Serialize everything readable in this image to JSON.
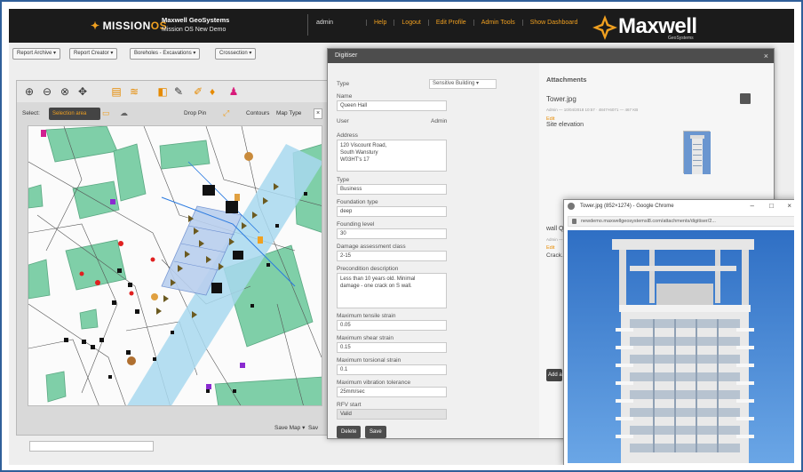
{
  "header": {
    "logo_mission": "MISSION",
    "logo_os": "OS",
    "company": "Maxwell GeoSystems",
    "subtitle": "Mission OS New Demo",
    "user": "admin",
    "nav": [
      "Help",
      "Logout",
      "Edit Profile",
      "Admin Tools",
      "Show Dashboard"
    ],
    "brand": "Maxwell",
    "brand_sub": "GeoSystems"
  },
  "report_toolbar": [
    "Report Archive",
    "Report Creator",
    "Boreholes - Excavations",
    "Crossection"
  ],
  "map_panel": {
    "select_label": "Select:",
    "select_mode": "Selection area",
    "drop_pin": "Drop Pin",
    "contours": "Contours",
    "map_type": "Map Type",
    "save_map": "Save Map",
    "save_map_more": "Sav"
  },
  "digitiser": {
    "title": "Digitiser",
    "close": "×",
    "type_label": "Type",
    "type_value": "Sensitive Building",
    "name_label": "Name",
    "name_value": "Queen Hall",
    "user_label": "User",
    "user_value": "Admin",
    "address_label": "Address",
    "address_value": "120 Viscount Road,\nSouth Wanstury\nW03HT's 17",
    "type2_label": "Type",
    "type2_value": "Business",
    "foundation_type_label": "Foundation type",
    "foundation_type_value": "deep",
    "founding_level_label": "Founding level",
    "founding_level_value": "30",
    "damage_label": "Damage assessment class",
    "damage_value": "2-15",
    "precondition_label": "Precondition description",
    "precondition_value": "Less than 10 years old. Minimal\ndamage - one crack on S wall.",
    "max_tensile_label": "Maximum tensile strain",
    "max_tensile_value": "0.05",
    "max_shear_label": "Maximum shear strain",
    "max_shear_value": "0.15",
    "max_torsional_label": "Maximum torsional strain",
    "max_torsional_value": "0.1",
    "max_vibration_label": "Maximum vibration tolerance",
    "max_vibration_value": "25mm/sec",
    "rfv_label": "RFV start",
    "rfv_value": "Valid",
    "delete_label": "Delete",
    "save_label": "Save"
  },
  "attachments": {
    "title": "Attachments",
    "file1": "Tower.jpg",
    "file1_meta": "Admin — 10/04/2018 10:57 · 4847×6071 — 467 KB",
    "file1_edit": "Edit",
    "file1_desc": "Site elevation",
    "file2": "wall Q...",
    "file2_meta": "Admin — ...",
    "file2_edit": "Edit",
    "file2_desc": "Crack...",
    "add_label": "Add a"
  },
  "browser": {
    "title": "Tower.jpg (852×1274) - Google Chrome",
    "url": "newdemo.maxwellgeosystemsl8.com/attachments/digitiser/2...",
    "min": "–",
    "max": "□",
    "close": "×"
  },
  "colors": {
    "accent": "#f0a020",
    "header_bg": "#1b1b1b",
    "map_green": "#7fcfa8",
    "corridor": "#a8d8ef"
  }
}
